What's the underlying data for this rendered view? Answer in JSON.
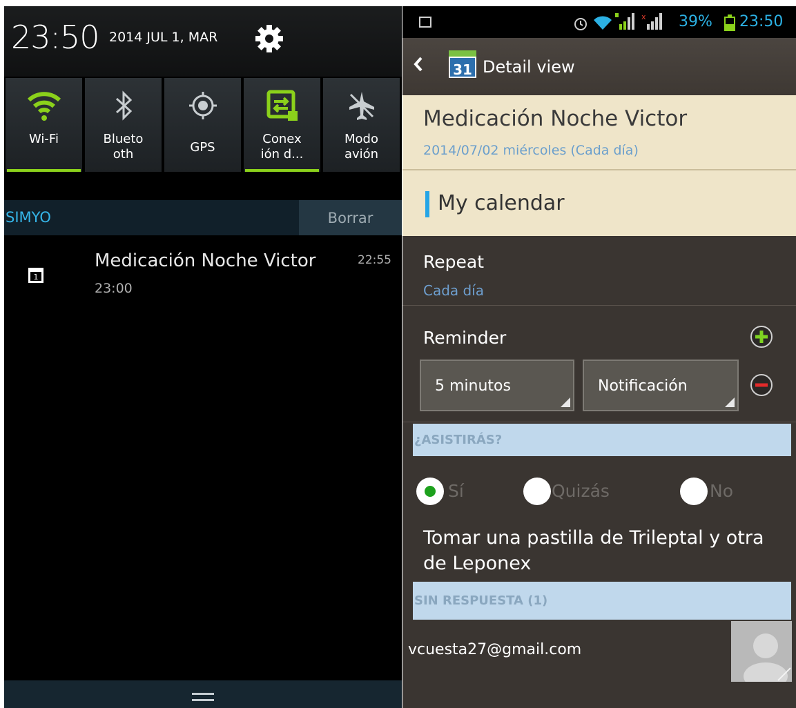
{
  "left_panel": {
    "clock": "23:50",
    "date": "2014 JUL 1, MAR",
    "quick_settings": [
      {
        "label_line1": "Wi-Fi",
        "label_line2": "",
        "active": true,
        "icon": "wifi-icon"
      },
      {
        "label_line1": "Blueto",
        "label_line2": "oth",
        "active": false,
        "icon": "bluetooth-icon"
      },
      {
        "label_line1": "GPS",
        "label_line2": "",
        "active": false,
        "icon": "gps-icon"
      },
      {
        "label_line1": "Conex",
        "label_line2": "ión d...",
        "active": true,
        "icon": "mobile-data-icon"
      },
      {
        "label_line1": "Modo",
        "label_line2": "avión",
        "active": false,
        "icon": "airplane-icon"
      }
    ],
    "carrier": "SIMYO",
    "clear_label": "Borrar",
    "notification": {
      "title": "Medicación Noche Victor",
      "time": "23:00",
      "timestamp": "22:55",
      "icon": "calendar-icon"
    }
  },
  "right_panel": {
    "status_bar": {
      "battery_percent": "39%",
      "time": "23:50"
    },
    "action_bar": {
      "calendar_day": "31",
      "title": "Detail view"
    },
    "event": {
      "title": "Medicación Noche Victor",
      "date": "2014/07/02 miércoles (Cada día)",
      "calendar_name": "My calendar"
    },
    "repeat": {
      "label": "Repeat",
      "value": "Cada día"
    },
    "reminder": {
      "label": "Reminder",
      "time_value": "5 minutos",
      "type_value": "Notificación"
    },
    "attendance": {
      "header": "¿ASISTIRÁS?",
      "options": [
        "Sí",
        "Quizás",
        "No"
      ],
      "selected": "Sí"
    },
    "description": "Tomar una pastilla de Trileptal y otra de Leponex",
    "no_response": {
      "header": "SIN RESPUESTA (1)",
      "email": "vcuesta27@gmail.com"
    }
  },
  "colors": {
    "accent_green": "#8bd11b",
    "accent_blue": "#2cb1e4",
    "header_cream": "#efe5c9",
    "section_blue": "#c0d8ec"
  }
}
